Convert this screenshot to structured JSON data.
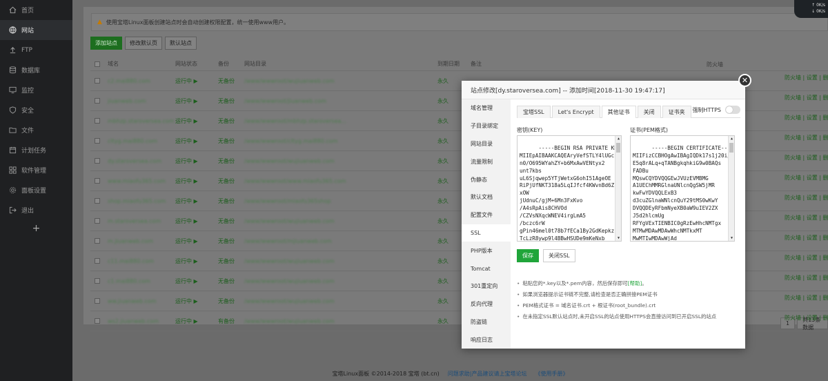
{
  "sidebar": {
    "items": [
      {
        "label": "首页",
        "icon": "home-icon"
      },
      {
        "label": "网站",
        "icon": "globe-icon",
        "active": true
      },
      {
        "label": "FTP",
        "icon": "upload-icon"
      },
      {
        "label": "数据库",
        "icon": "database-icon"
      },
      {
        "label": "监控",
        "icon": "monitor-icon"
      },
      {
        "label": "安全",
        "icon": "shield-icon"
      },
      {
        "label": "文件",
        "icon": "folder-icon"
      },
      {
        "label": "计划任务",
        "icon": "calendar-icon"
      },
      {
        "label": "软件管理",
        "icon": "grid-icon"
      },
      {
        "label": "面板设置",
        "icon": "gear-icon"
      },
      {
        "label": "退出",
        "icon": "logout-icon"
      }
    ],
    "add_label": "+"
  },
  "net_widget": {
    "up": "0K/s",
    "down": "0K/s"
  },
  "notice": {
    "icon": "warning-icon",
    "text": "使用宝塔Linux面板创建站点时会自动创建权限配置，统一使用www用户。"
  },
  "toolbar": {
    "add_site": "添加站点",
    "edit_default_page": "修改默认页",
    "default_site": "默认站点"
  },
  "table": {
    "headers": {
      "name": "域名",
      "status": "网站状态",
      "backup": "备份",
      "root": "网站目录",
      "expire": "到期日期",
      "remark": "备注",
      "firewall": "防火墙"
    },
    "rows": [
      {
        "name": "c2.mai880.com",
        "status": "运行中 ▶",
        "backup": "无备份",
        "root": "/www/wwwroot/wujiuanweb.com",
        "expire": "永久"
      },
      {
        "name": "jiuanweb.com",
        "status": "运行中 ▶",
        "backup": "无备份",
        "root": "/www/wwwroot/jiuanweb.com",
        "expire": "永久"
      },
      {
        "name": "mbhzp.staroversea.com",
        "status": "运行中 ▶",
        "backup": "无备份",
        "root": "/www/wwwroot/mbhzp.staroversea...",
        "expire": "永久"
      },
      {
        "name": "cltyg.mai880.com",
        "status": "运行中 ▶",
        "backup": "无备份",
        "root": "/www/wwwroot/cltyg.mai880.com",
        "expire": "永久"
      },
      {
        "name": "dy.staroversea.com",
        "status": "运行中 ▶",
        "backup": "无备份",
        "root": "/www/wwwroot/wujiuanweb.com",
        "expire": "永久"
      },
      {
        "name": "www.miaofu365.com",
        "status": "运行中 ▶",
        "backup": "无备份",
        "root": "/www/wwwroot/www.miaofu365.com",
        "expire": "永久"
      },
      {
        "name": "shop.miaofu365.com",
        "status": "运行中 ▶",
        "backup": "无备份",
        "root": "/www/wwwroot/miaofu365shop",
        "expire": "永久"
      },
      {
        "name": "m.staroversea.com",
        "status": "运行中 ▶",
        "backup": "无备份",
        "root": "/www/wwwroot/wujiuanweb.com",
        "expire": "永久"
      },
      {
        "name": "m.jiuanweb.com",
        "status": "运行中 ▶",
        "backup": "无备份",
        "root": "/www/wwwroot/mjiuanweb.com",
        "expire": "永久"
      },
      {
        "name": "c11.mai880.com",
        "status": "运行中 ▶",
        "backup": "无备份",
        "root": "/www/wwwroot/wujiuanweb.com",
        "expire": "永久"
      },
      {
        "name": "c1.mai880.com",
        "status": "运行中 ▶",
        "backup": "无备份",
        "root": "/www/wwwroot/wujiuanweb.com",
        "expire": "永久"
      },
      {
        "name": "ww.jiuanweb.com",
        "status": "运行中 ▶",
        "backup": "无备份",
        "root": "/www/wwwroot/wujiuanweb.com",
        "expire": "永久"
      },
      {
        "name": "ws2.jiuanweb.com",
        "status": "运行中 ▶",
        "backup": "有备份",
        "root": "/www/wwwroot/wujiuanweb.com",
        "expire": "永久"
      }
    ],
    "row_actions": "防火墙 | 设置 | 删除",
    "first_remark": "c2.mai880.com"
  },
  "pager": {
    "page": "1",
    "total": "共13条数据"
  },
  "footer": {
    "copyright": "宝塔Linux面板 ©2014-2018 宝塔 (bt.cn)",
    "feedback": "问题求助|产品建议请上宝塔论坛",
    "manual": "《使用手册》"
  },
  "modal": {
    "title": "站点修改[dy.staroversea.com] -- 添加时间[2018-11-30 19:47:17]",
    "close_icon": "close-icon",
    "menu": [
      "域名管理",
      "子目录绑定",
      "网站目录",
      "流量限制",
      "伪静态",
      "默认文档",
      "配置文件",
      "SSL",
      "PHP版本",
      "Tomcat",
      "301重定向",
      "反向代理",
      "防盗链",
      "响应日志"
    ],
    "active_menu": "SSL",
    "tabs": [
      "宝塔SSL",
      "Let's Encrypt",
      "其他证书",
      "关闭",
      "证书夹"
    ],
    "active_tab": "其他证书",
    "force_https": "强制HTTPS",
    "key_label": "密钥(KEY)",
    "cert_label": "证书(PEM格式)",
    "key_text": "-----BEGIN RSA PRIVATE KEY-----\nMIIEpAIBAAKCAQEAryVefSTLY4lUGc\nn0/O695WYahZY+b6MxAwVENtyx2\nunt7kbs\nuL6Sjqwep5YTjWetxG6ohI51AgeOE\nRiPjUfNKT318a5LqIJfcf4KWvnBd6Z1\nxOW\njUdnuC/gjM+6Mn3FxKvo\n/A4sRpAis8CHVOd\n/CZVsNXqcWNEV4irgLmA5\n/bczc6rW\ngPin46mel0t78b7fECa1By2GdKepkz\nTcLzR8ywp9l4BBwHSUDe9mKeNxb",
    "cert_text": "-----BEGIN CERTIFICATE-----\nMIIFizCCBHOgAwIBAgIQDk17s1j20i/\nE5q8rALq+qTANBgkqhkiG9w0BAQs\nFADBu\nMQswCQYDVQQGEwJVUzEVMBMG\nA1UEChMMRGlnaUNlcnQgSW5jMR\nkwFwYDVQQLExB3\nd3cuZGlnaWNlcnQuY29tMS0wKwY\nDVQQDEyRFbmNyeXB0aW9uIEV2ZX\nJ5d2hlcmUg\nRFYgVExTIENBIC0gRzEwHhcNMTgx\nMTMwMDAwMDAwWhcNMTkxMT\nMwMTIwMDAwWjAd",
    "save_button": "保存",
    "close_ssl_button": "关闭SSL",
    "tips": [
      {
        "text": "粘贴您的*.key以及*.pem内容，然后保存即可",
        "link": "[帮助]",
        "tail": "。"
      },
      {
        "text": "如果浏览器提示证书链不完整,请检查是否正确拼接PEM证书",
        "link": "",
        "tail": ""
      },
      {
        "text": "PEM格式证书 = 域名证书.crt + 根证书(root_bundle).crt",
        "link": "",
        "tail": ""
      },
      {
        "text": "在未指定SSL默认站点时,未开启SSL的站点使用HTTPS会直接访问到已开启SSL的站点",
        "link": "",
        "tail": ""
      }
    ]
  }
}
